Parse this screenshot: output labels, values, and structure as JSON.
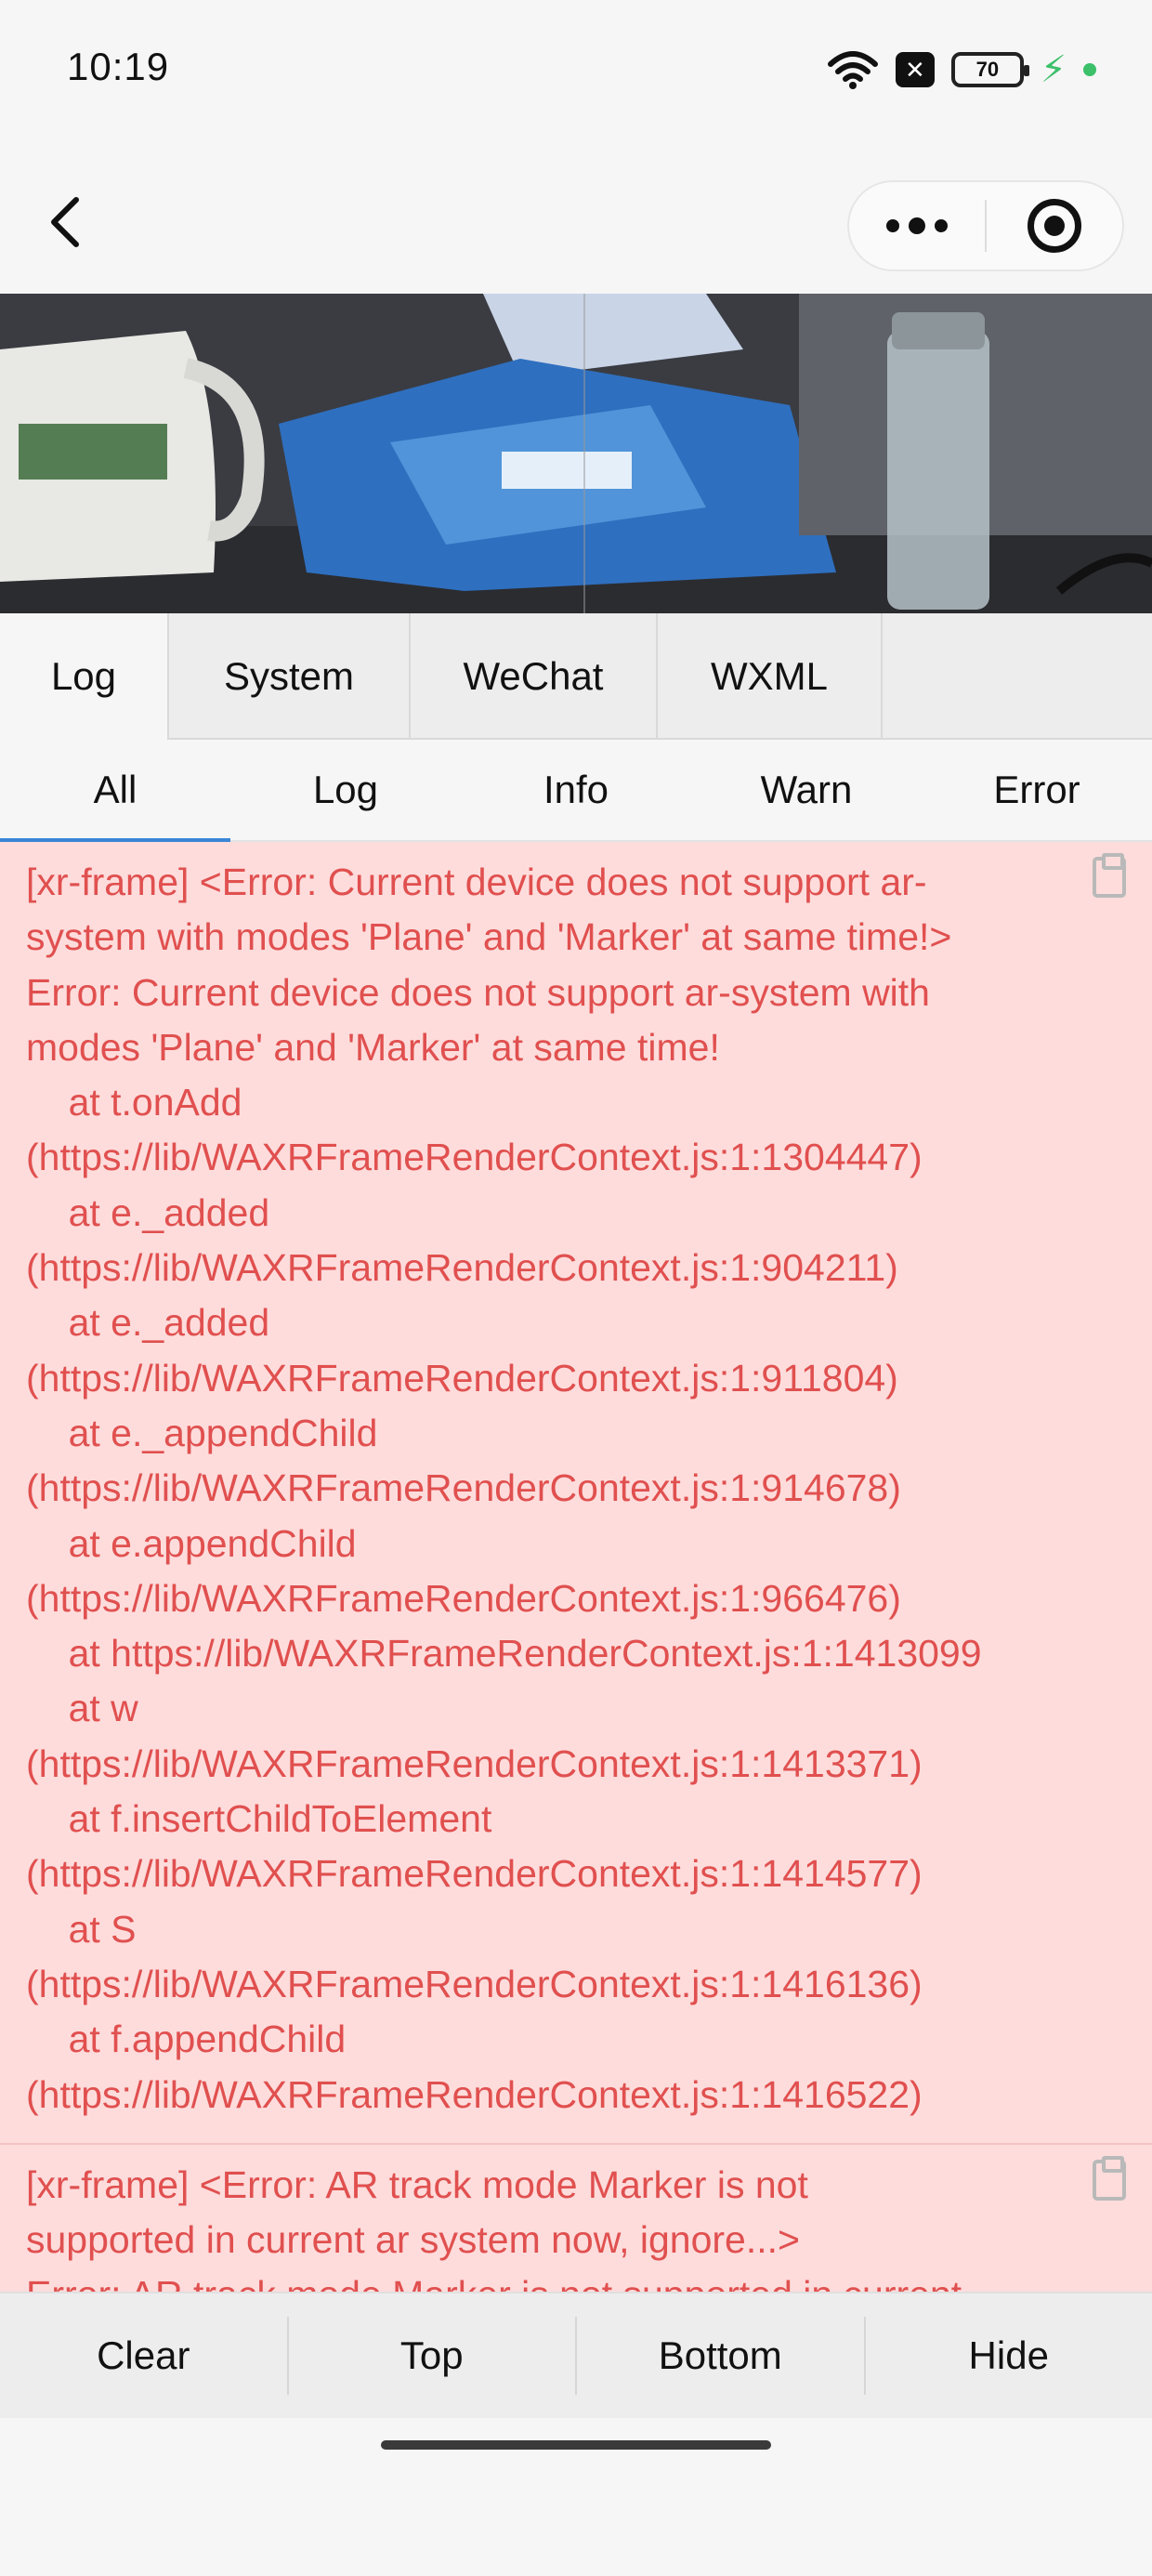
{
  "status_bar": {
    "time": "10:19",
    "battery_level": "70",
    "notification_badge": "✕"
  },
  "nav": {
    "more_label": "•••"
  },
  "console": {
    "tabs": [
      {
        "label": "Log",
        "active": true
      },
      {
        "label": "System",
        "active": false
      },
      {
        "label": "WeChat",
        "active": false
      },
      {
        "label": "WXML",
        "active": false
      }
    ],
    "filters": [
      {
        "label": "All",
        "active": true
      },
      {
        "label": "Log",
        "active": false
      },
      {
        "label": "Info",
        "active": false
      },
      {
        "label": "Warn",
        "active": false
      },
      {
        "label": "Error",
        "active": false
      }
    ],
    "entries": [
      {
        "lines": [
          "[xr-frame] <Error: Current device does not support ar-",
          "system with modes 'Plane' and 'Marker' at same time!>",
          "Error: Current device does not support ar-system with",
          "modes 'Plane' and 'Marker' at same time!",
          "    at t.onAdd",
          "(https://lib/WAXRFrameRenderContext.js:1:1304447)",
          "    at e._added",
          "(https://lib/WAXRFrameRenderContext.js:1:904211)",
          "    at e._added",
          "(https://lib/WAXRFrameRenderContext.js:1:911804)",
          "    at e._appendChild",
          "(https://lib/WAXRFrameRenderContext.js:1:914678)",
          "    at e.appendChild",
          "(https://lib/WAXRFrameRenderContext.js:1:966476)",
          "    at https://lib/WAXRFrameRenderContext.js:1:1413099",
          "    at w",
          "(https://lib/WAXRFrameRenderContext.js:1:1413371)",
          "    at f.insertChildToElement",
          "(https://lib/WAXRFrameRenderContext.js:1:1414577)",
          "    at S",
          "(https://lib/WAXRFrameRenderContext.js:1:1416136)",
          "    at f.appendChild",
          "(https://lib/WAXRFrameRenderContext.js:1:1416522)"
        ]
      },
      {
        "lines": [
          "[xr-frame] <Error: AR track mode Marker is not",
          "supported in current ar system now, ignore...>",
          "Error: AR track mode Marker is not supported in current"
        ]
      }
    ],
    "tools": [
      "Clear",
      "Top",
      "Bottom",
      "Hide"
    ]
  },
  "colors": {
    "error_text": "#e0504f",
    "error_bg": "#fedcdc",
    "active_underline": "#3a86d6",
    "charging": "#3cc06a"
  }
}
